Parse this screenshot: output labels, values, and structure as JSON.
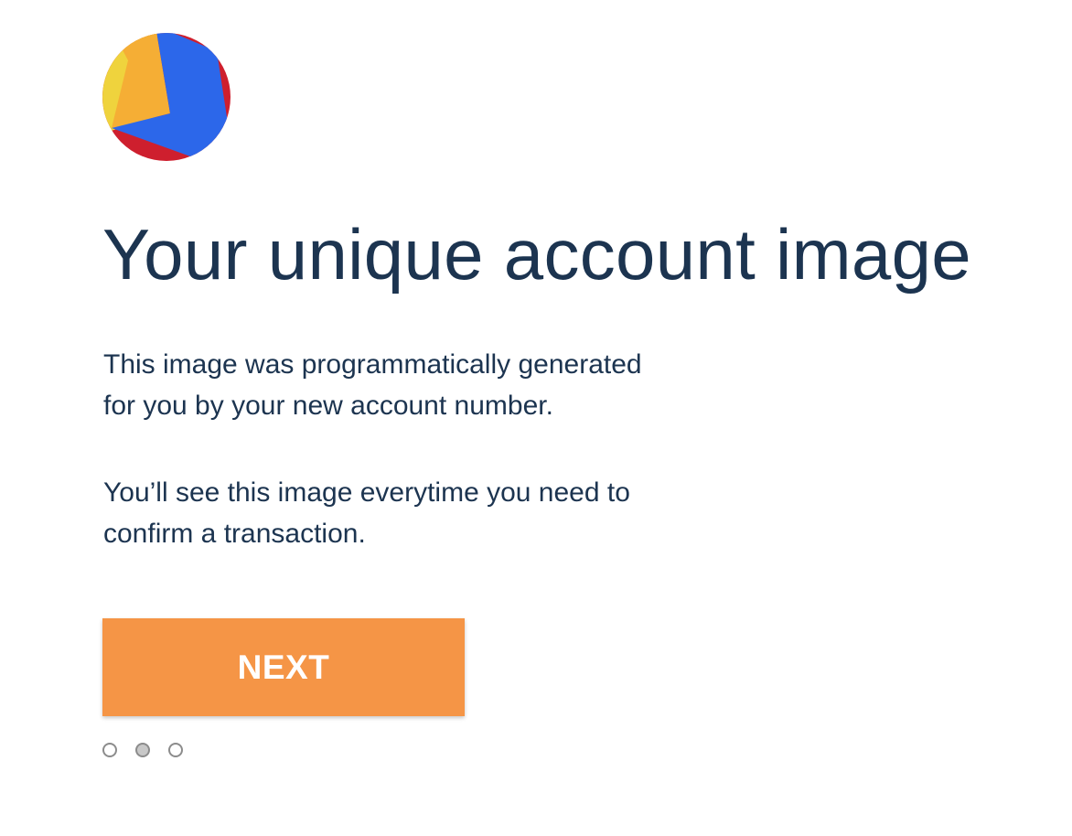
{
  "avatar": {
    "icon": "account-identicon",
    "colors": [
      "#2c67ea",
      "#f5ae35",
      "#efd33d",
      "#ce1f2e"
    ]
  },
  "title": "Your unique account image",
  "paragraphs": [
    {
      "line1": "This image was programmatically generated",
      "line2": "for you by your new account number."
    },
    {
      "line1": "You’ll see this image everytime you need to",
      "line2": "confirm a transaction."
    }
  ],
  "next_button": {
    "label": "NEXT",
    "color": "#f59546"
  },
  "pagination": {
    "total": 3,
    "current": 2
  },
  "colors": {
    "text": "#1c3450",
    "background": "#ffffff"
  }
}
